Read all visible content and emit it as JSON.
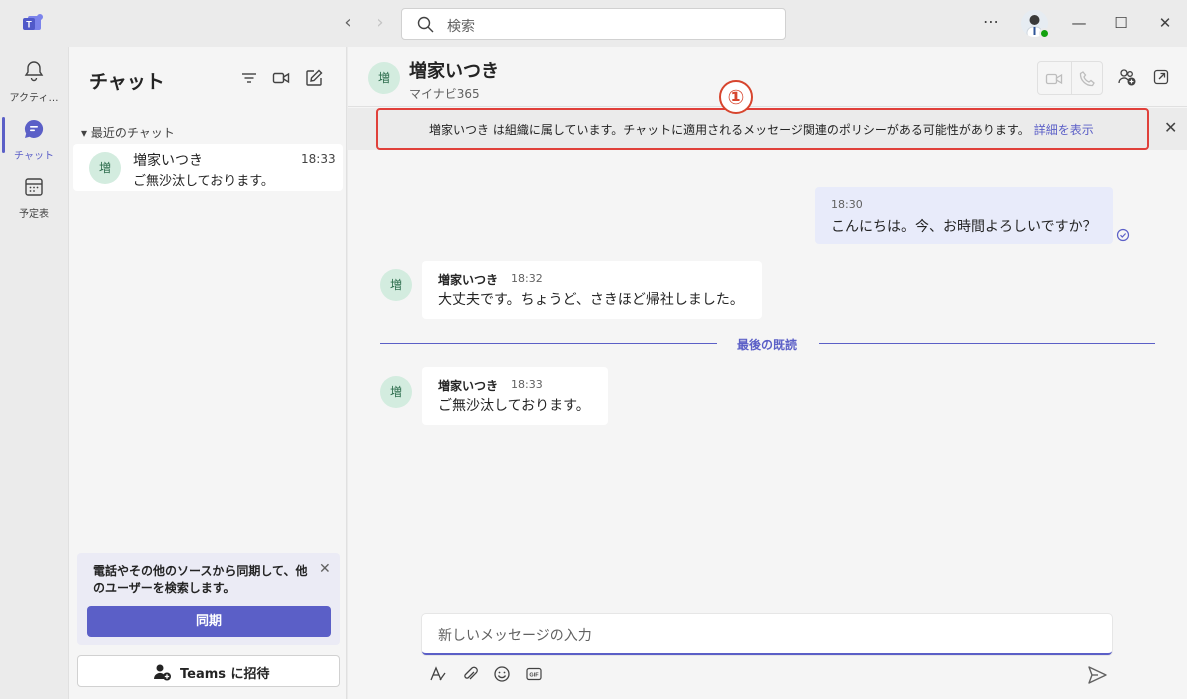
{
  "titlebar": {
    "search_placeholder": "検索",
    "more_label": "⋯",
    "min_label": "—",
    "max_label": "☐",
    "close_label": "✕",
    "back_label": "‹",
    "forward_label": "›"
  },
  "rail": {
    "items": [
      {
        "label": "アクティ…",
        "icon": "bell-icon"
      },
      {
        "label": "チャット",
        "icon": "chat-icon",
        "active": true
      },
      {
        "label": "予定表",
        "icon": "calendar-icon"
      }
    ]
  },
  "chat_list": {
    "title": "チャット",
    "section_label": "▾ 最近のチャット",
    "items": [
      {
        "avatar": "増",
        "name": "増家いつき",
        "time": "18:33",
        "preview": "ご無沙汰しております。"
      }
    ],
    "sync_card": {
      "text": "電話やその他のソースから同期して、他のユーザーを検索します。",
      "close": "✕",
      "button": "同期"
    },
    "invite_button": "Teams に招待"
  },
  "chat": {
    "header": {
      "avatar": "増",
      "name": "増家いつき",
      "org": "マイナビ365"
    },
    "policy": {
      "text": "増家いつき は組織に属しています。チャットに適用されるメッセージ関連のポリシーがある可能性があります。",
      "link": "詳細を表示",
      "close": "✕"
    },
    "step_badge": "①",
    "messages": [
      {
        "mine": true,
        "time": "18:30",
        "body": "こんにちは。今、お時間よろしいですか？"
      },
      {
        "mine": false,
        "avatar": "増",
        "name": "増家いつき",
        "time": "18:32",
        "body": "大丈夫です。ちょうど、さきほど帰社しました。"
      },
      {
        "mine": false,
        "avatar": "増",
        "name": "増家いつき",
        "time": "18:33",
        "body": "ご無沙汰しております。"
      }
    ],
    "last_read_label": "最後の既読",
    "composer_placeholder": "新しいメッセージの入力"
  },
  "colors": {
    "accent": "#5b5fc7",
    "highlight": "#e0403a",
    "presence": "#13a10e"
  }
}
